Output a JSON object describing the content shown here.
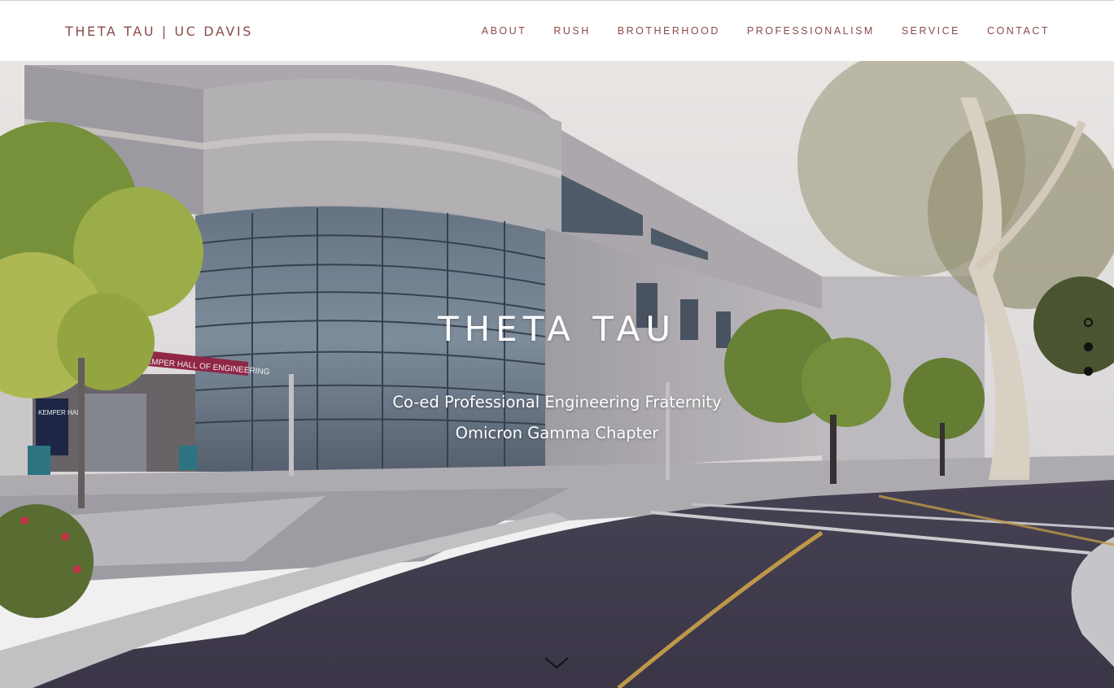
{
  "site": {
    "title": "THETA TAU | UC DAVIS"
  },
  "nav": {
    "items": [
      {
        "label": "ABOUT"
      },
      {
        "label": "RUSH"
      },
      {
        "label": "BROTHERHOOD"
      },
      {
        "label": "PROFESSIONALISM"
      },
      {
        "label": "SERVICE"
      },
      {
        "label": "CONTACT"
      }
    ]
  },
  "hero": {
    "title": "THETA TAU",
    "subtitle_line1": "Co-ed Professional Engineering Fraternity",
    "subtitle_line2": "Omicron Gamma Chapter",
    "photo_signs": {
      "banner": "JOHN D. KEMPER HALL OF ENGINEERING",
      "kiosk": "KEMPER HALL"
    }
  },
  "slides": {
    "count": 3,
    "active_index": 0
  },
  "icons": {
    "scroll": "chevron-down-icon"
  },
  "colors": {
    "nav_text": "#8a4b4b",
    "header_bg": "#ffffff",
    "hero_text": "#ffffff"
  }
}
